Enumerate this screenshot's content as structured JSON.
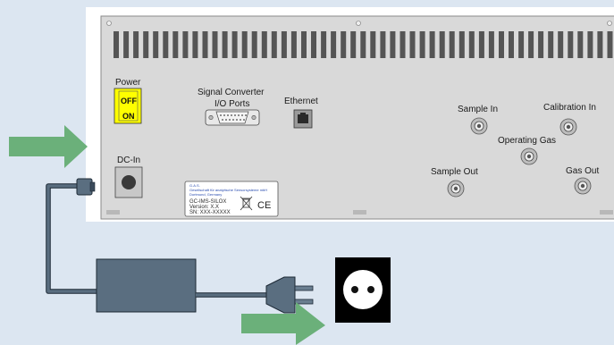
{
  "panel": {
    "power_label": "Power",
    "switch_off": "OFF",
    "switch_on": "ON",
    "signal_converter_line1": "Signal Converter",
    "signal_converter_line2": "I/O Ports",
    "ethernet_label": "Ethernet",
    "sample_in_label": "Sample In",
    "calibration_in_label": "Calibration In",
    "operating_gas_label": "Operating Gas",
    "sample_out_label": "Sample Out",
    "gas_out_label": "Gas Out",
    "dc_in_label": "DC-In"
  },
  "nameplate": {
    "brand": "G.A.S.",
    "company_line1": "Gesellschaft für analytische Sensorsysteme mbH",
    "company_line2": "Dortmund, Germany",
    "model": "GC-IMS-SILOX",
    "version": "Version: X.X",
    "serial": "SN: XXX-XXXXX",
    "ce_mark": "CE"
  },
  "colors": {
    "background": "#dce6f1",
    "panel": "#ffffff",
    "inner_panel": "#d9d9d9",
    "switch": "#ffff00",
    "arrow": "#6bb07a",
    "adapter": "#5a6e80",
    "cable": "#3a4a5a",
    "socket": "#000000"
  }
}
